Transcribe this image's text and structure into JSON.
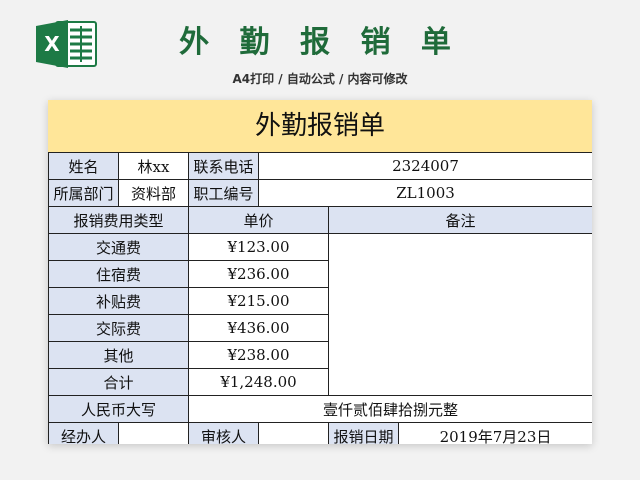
{
  "header": {
    "title": "外 勤 报 销 单",
    "subtitle": "A4打印 / 自动公式 / 内容可修改",
    "logo_letter": "X"
  },
  "form": {
    "title": "外勤报销单",
    "name_label": "姓名",
    "name_value": "林xx",
    "phone_label": "联系电话",
    "phone_value": "2324007",
    "dept_label": "所属部门",
    "dept_value": "资料部",
    "staff_id_label": "职工编号",
    "staff_id_value": "ZL1003",
    "col_type": "报销费用类型",
    "col_price": "单价",
    "col_note": "备注",
    "items": [
      {
        "type": "交通费",
        "price": "¥123.00"
      },
      {
        "type": "住宿费",
        "price": "¥236.00"
      },
      {
        "type": "补贴费",
        "price": "¥215.00"
      },
      {
        "type": "交际费",
        "price": "¥436.00"
      },
      {
        "type": "其他",
        "price": "¥238.00"
      }
    ],
    "total_label": "合计",
    "total_value": "¥1,248.00",
    "rmb_label": "人民币大写",
    "rmb_value": "壹仟贰佰肆拾捌元整",
    "handler_label": "经办人",
    "reviewer_label": "审核人",
    "date_label": "报销日期",
    "date_value": "2019年7月23日"
  },
  "colors": {
    "title_green": "#1f6b3a",
    "header_yellow": "#ffe699",
    "label_blue": "#dce3f2",
    "excel_green": "#1d7a45"
  }
}
